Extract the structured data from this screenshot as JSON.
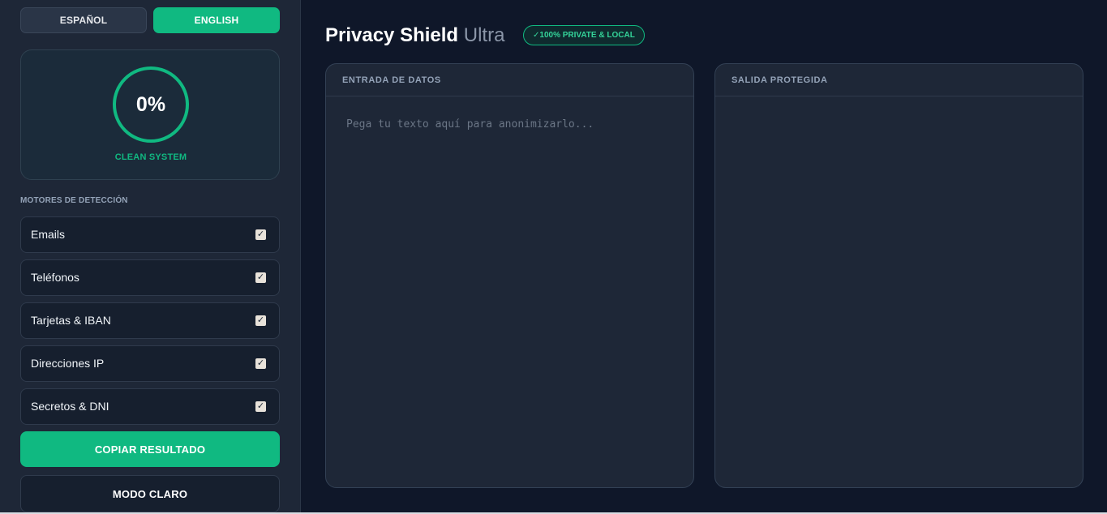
{
  "language": {
    "options": [
      {
        "label": "ESPAÑOL",
        "active": false
      },
      {
        "label": "ENGLISH",
        "active": true
      }
    ]
  },
  "score": {
    "value": "0%",
    "label": "CLEAN SYSTEM"
  },
  "engines": {
    "title": "MOTORES DE DETECCIÓN",
    "items": [
      {
        "label": "Emails",
        "checked": true
      },
      {
        "label": "Teléfonos",
        "checked": true
      },
      {
        "label": "Tarjetas & IBAN",
        "checked": true
      },
      {
        "label": "Direcciones IP",
        "checked": true
      },
      {
        "label": "Secretos & DNI",
        "checked": true
      }
    ]
  },
  "actions": {
    "copy_label": "COPIAR RESULTADO",
    "mode_label": "MODO CLARO"
  },
  "header": {
    "title": "Privacy Shield",
    "subtitle": "Ultra",
    "badge": "✓100% PRIVATE & LOCAL"
  },
  "input_panel": {
    "title": "ENTRADA DE DATOS",
    "placeholder": "Pega tu texto aquí para anonimizarlo...",
    "value": ""
  },
  "output_panel": {
    "title": "SALIDA PROTEGIDA",
    "value": ""
  },
  "colors": {
    "accent": "#10b981",
    "background": "#0f1729",
    "sidebar": "#1e2737"
  }
}
